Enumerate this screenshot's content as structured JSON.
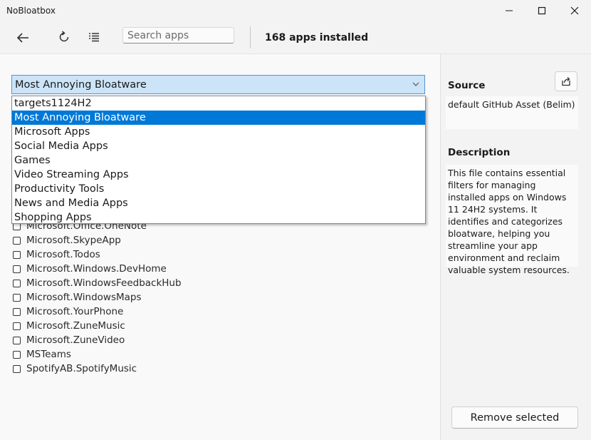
{
  "window": {
    "title": "NoBloatbox"
  },
  "toolbar": {
    "search_placeholder": "Search apps",
    "status": "168 apps installed"
  },
  "filter": {
    "selected": "Most Annoying Bloatware",
    "options": [
      "targets1124H2",
      "Most Annoying Bloatware",
      "Microsoft Apps",
      "Social Media Apps",
      "Games",
      "Video Streaming Apps",
      "Productivity Tools",
      "News and Media Apps",
      "Shopping Apps"
    ],
    "highlighted_index": 1
  },
  "apps": [
    "Microsoft.Office.OneNote",
    "Microsoft.SkypeApp",
    "Microsoft.Todos",
    "Microsoft.Windows.DevHome",
    "Microsoft.WindowsFeedbackHub",
    "Microsoft.WindowsMaps",
    "Microsoft.YourPhone",
    "Microsoft.ZuneMusic",
    "Microsoft.ZuneVideo",
    "MSTeams",
    "SpotifyAB.SpotifyMusic"
  ],
  "details": {
    "source_title": "Source",
    "source_value": "default GitHub Asset (Belim)",
    "description_title": "Description",
    "description_text": "This file contains essential filters for managing installed apps on Windows 11 24H2 systems. It identifies and categorizes bloatware, helping you streamline your app environment and reclaim valuable system resources."
  },
  "actions": {
    "remove_label": "Remove selected"
  },
  "icons": {
    "back": "back-arrow-icon",
    "refresh": "refresh-icon",
    "list": "list-icon",
    "share": "share-icon",
    "minimize": "minimize-icon",
    "maximize": "maximize-icon",
    "close": "close-icon",
    "dropdown": "chevron-down-icon"
  },
  "colors": {
    "accent": "#0078d7",
    "combo_bg": "#cce4f7"
  }
}
